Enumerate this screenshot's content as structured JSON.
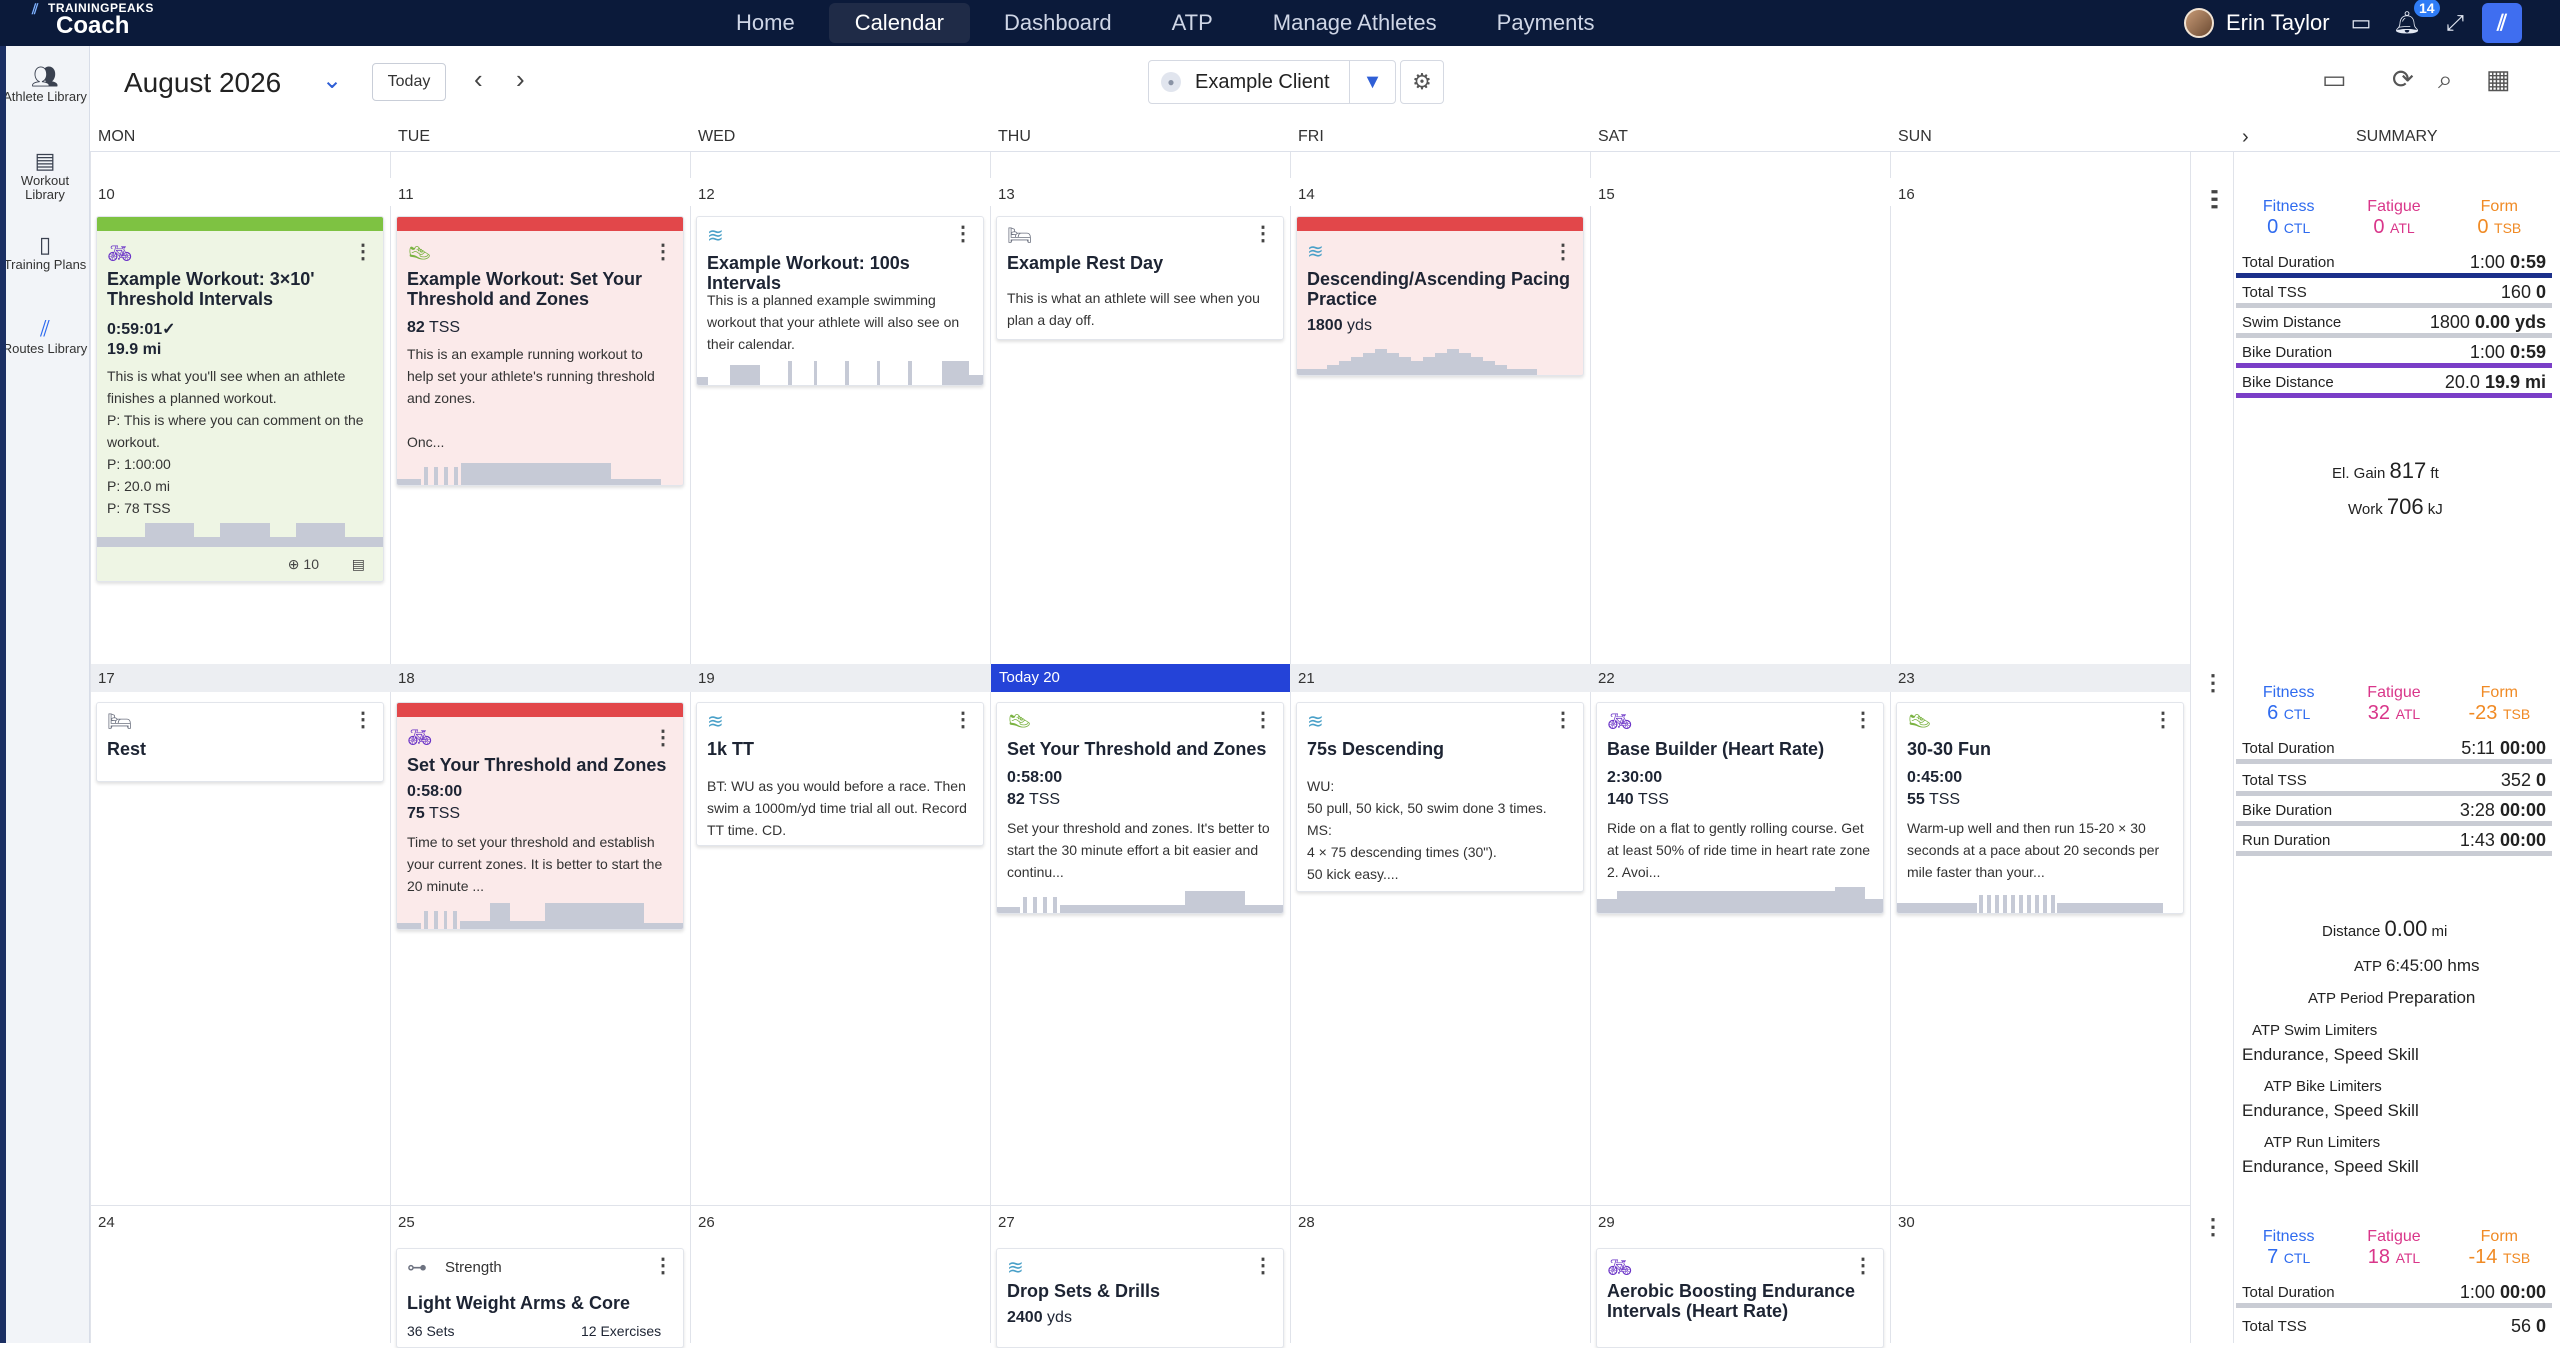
{
  "topbar": {
    "brand": "TRAININGPEAKS",
    "product": "Coach",
    "nav": [
      "Home",
      "Calendar",
      "Dashboard",
      "ATP",
      "Manage Athletes",
      "Payments"
    ],
    "active_nav": "Calendar",
    "user_name": "Erin Taylor",
    "notif_count": "14"
  },
  "sidebar": {
    "items": [
      {
        "label": "Athlete Library",
        "icon": "athlete-icon"
      },
      {
        "label": "Workout Library",
        "icon": "workout-library-icon"
      },
      {
        "label": "Training Plans",
        "icon": "book-icon"
      },
      {
        "label": "Routes Library",
        "icon": "routes-icon"
      }
    ]
  },
  "toolbar": {
    "month": "August 2026",
    "today_label": "Today",
    "client": "Example Client"
  },
  "days": [
    "MON",
    "TUE",
    "WED",
    "THU",
    "FRI",
    "SAT",
    "SUN"
  ],
  "summary_label": "SUMMARY",
  "weeks": [
    {
      "dates": [
        "10",
        "11",
        "12",
        "13",
        "14",
        "15",
        "16"
      ],
      "summary": {
        "fitness": "0",
        "fatigue": "0",
        "form": "0",
        "rows": [
          {
            "label": "Total Duration",
            "plan": "1:00",
            "done": "0:59"
          },
          {
            "label": "Total TSS",
            "plan": "160",
            "done": "0"
          },
          {
            "label": "Swim Distance",
            "plan": "1800",
            "done": "0.00 yds"
          },
          {
            "label": "Bike Duration",
            "plan": "1:00",
            "done": "0:59"
          },
          {
            "label": "Bike Distance",
            "plan": "20.0",
            "done": "19.9 mi"
          }
        ],
        "elgain_label": "El. Gain",
        "elgain": "817",
        "elgain_unit": "ft",
        "work_label": "Work",
        "work": "706",
        "work_unit": "kJ"
      }
    },
    {
      "dates": [
        "17",
        "18",
        "Today 20",
        "21",
        "22",
        "23"
      ],
      "wed": "19",
      "summary": {
        "fitness": "6",
        "fatigue": "32",
        "form": "-23",
        "rows": [
          {
            "label": "Total Duration",
            "plan": "5:11",
            "done": "00:00"
          },
          {
            "label": "Total TSS",
            "plan": "352",
            "done": "0"
          },
          {
            "label": "Bike Duration",
            "plan": "3:28",
            "done": "00:00"
          },
          {
            "label": "Run Duration",
            "plan": "1:43",
            "done": "00:00"
          }
        ],
        "distance_label": "Distance",
        "distance": "0.00",
        "distance_unit": "mi",
        "atp_label": "ATP",
        "atp": "6:45:00 hms",
        "atp_period_label": "ATP Period",
        "atp_period": "Preparation",
        "swim_lim_label": "ATP Swim Limiters",
        "swim_lim": "Endurance, Speed Skill",
        "bike_lim_label": "ATP Bike Limiters",
        "bike_lim": "Endurance, Speed Skill",
        "run_lim_label": "ATP Run Limiters",
        "run_lim": "Endurance, Speed Skill"
      }
    },
    {
      "dates": [
        "24",
        "25",
        "26",
        "27",
        "28",
        "29",
        "30"
      ],
      "summary": {
        "fitness": "7",
        "fatigue": "18",
        "form": "-14",
        "rows": [
          {
            "label": "Total Duration",
            "plan": "1:00",
            "done": "00:00"
          },
          {
            "label": "Total TSS",
            "plan": "56",
            "done": "0"
          }
        ]
      }
    }
  ],
  "labels": {
    "fitness": "Fitness",
    "fatigue": "Fatigue",
    "form": "Form",
    "ctl": "CTL",
    "atl": "ATL",
    "tsb": "TSB"
  },
  "cards": {
    "c1": {
      "title": "Example Workout: 3×10' Threshold Intervals",
      "m1": "0:59:01✓",
      "m2": "19.9 mi",
      "desc": "This is what you'll see when an athlete finishes a planned workout.\nP: This is where you can comment on the workout.\nP: 1:00:00\nP: 20.0 mi\nP: 78 TSS",
      "foot1": "10"
    },
    "c2": {
      "title": "Example Workout: Set Your Threshold and Zones",
      "m2v": "82",
      "m2u": "TSS",
      "desc": "This is an example running workout to help set your athlete's running threshold and zones.\n\nOnc..."
    },
    "c3": {
      "title": "Example Workout: 100s Intervals",
      "desc": "This is a planned example swimming workout that your athlete will also see on their calendar."
    },
    "c4": {
      "title": "Example Rest Day",
      "desc": "This is what an athlete will see when you plan a day off."
    },
    "c5": {
      "title": "Descending/Ascending Pacing Practice",
      "m2v": "1800",
      "m2u": "yds"
    },
    "c6": {
      "title": "Rest"
    },
    "c7": {
      "title": "Set Your Threshold and Zones",
      "m1": "0:58:00",
      "m2v": "75",
      "m2u": "TSS",
      "desc": "Time to set your threshold and establish your current zones. It is better to start the 20 minute ..."
    },
    "c8": {
      "title": "1k TT",
      "desc": "BT: WU as you would before a race. Then swim a 1000m/yd time trial all out. Record TT time. CD."
    },
    "c9": {
      "title": "Set Your Threshold and Zones",
      "m1": "0:58:00",
      "m2v": "82",
      "m2u": "TSS",
      "desc": "Set your threshold and zones. It's better to start the 30 minute effort a bit easier and continu..."
    },
    "c10": {
      "title": "75s Descending",
      "desc": "WU:\n50 pull, 50 kick, 50 swim done 3 times.\nMS:\n4 × 75 descending times (30\").\n50 kick easy...."
    },
    "c11": {
      "title": "Base Builder (Heart Rate)",
      "m1": "2:30:00",
      "m2v": "140",
      "m2u": "TSS",
      "desc": "Ride on a flat to gently rolling course. Get at least 50% of ride time in heart rate zone 2. Avoi..."
    },
    "c12": {
      "title": "30-30 Fun",
      "m1": "0:45:00",
      "m2v": "55",
      "m2u": "TSS",
      "desc": "Warm-up well and then run 15-20 × 30 seconds at a pace about 20 seconds per mile faster than your..."
    },
    "c13": {
      "tag": "Strength",
      "title": "Light Weight Arms & Core",
      "extra1": "36 Sets",
      "extra2": "12 Exercises"
    },
    "c14": {
      "title": "Drop Sets & Drills",
      "m2v": "2400",
      "m2u": "yds"
    },
    "c15": {
      "title": "Aerobic Boosting Endurance Intervals (Heart Rate)"
    }
  },
  "colors": {
    "green": "#7ec242",
    "red": "#e2474a",
    "today": "#2443d8",
    "fitness": "#2f6bef",
    "fatigue": "#d9368a",
    "form": "#f08a24"
  }
}
